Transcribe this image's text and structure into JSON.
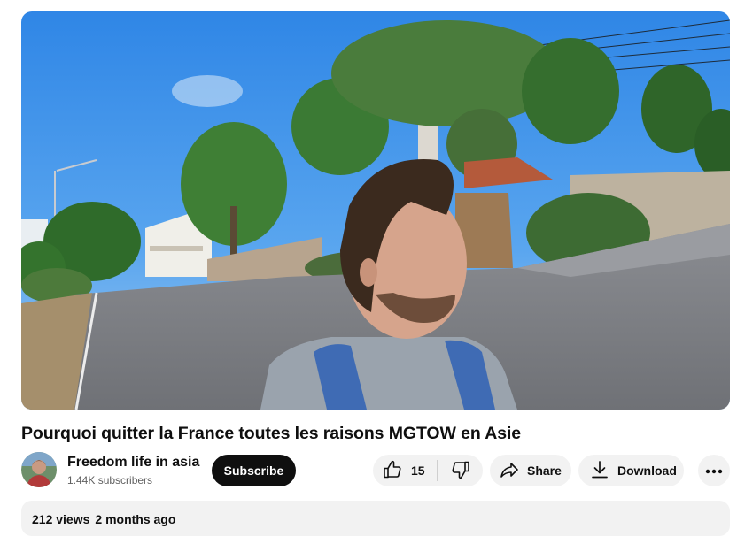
{
  "video": {
    "title": "Pourquoi quitter la France toutes les raisons MGTOW en Asie"
  },
  "channel": {
    "name": "Freedom life in asia",
    "subscribers": "1.44K subscribers",
    "subscribe_label": "Subscribe"
  },
  "actions": {
    "like_count": "15",
    "share_label": "Share",
    "download_label": "Download"
  },
  "description": {
    "views": "212 views",
    "date": "2 months ago"
  },
  "icons": [
    "thumbs-up-icon",
    "thumbs-down-icon",
    "share-icon",
    "download-icon",
    "more-icon"
  ]
}
